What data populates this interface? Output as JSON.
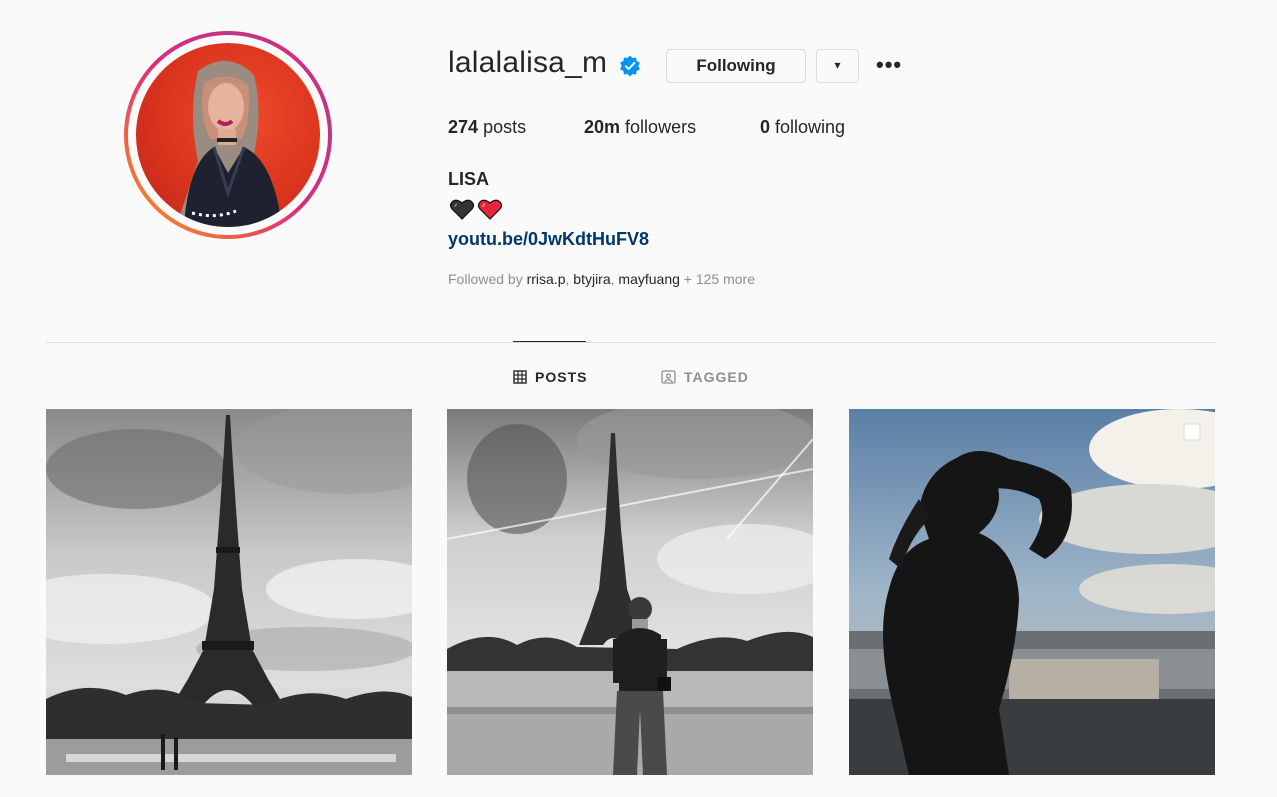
{
  "profile": {
    "username": "lalalalisa_m",
    "verified": true,
    "following_label": "Following",
    "dropdown_glyph": "▾",
    "more_glyph": "•••",
    "posts_count": "274",
    "posts_label": "posts",
    "followers_count": "20m",
    "followers_label": "followers",
    "following_count": "0",
    "following_stat_label": "following",
    "full_name": "LISA",
    "bio_emoji": "🖤❤️",
    "bio_link": "youtu.be/0JwKdtHuFV8",
    "followed_by_prefix": "Followed by",
    "followed_by_names": [
      "rrisa.p",
      "btyjira",
      "mayfuang"
    ],
    "followed_by_more": "+ 125 more",
    "accent_color": "#0095f6",
    "link_color": "#00376b"
  },
  "tabs": [
    {
      "label": "POSTS",
      "icon": "grid-icon",
      "active": true
    },
    {
      "label": "TAGGED",
      "icon": "tagged-icon",
      "active": false
    }
  ],
  "posts": [
    {
      "icon": "eiffel-tower-photo"
    },
    {
      "icon": "eiffel-tower-portrait-photo"
    },
    {
      "icon": "paris-rooftop-photo",
      "multi": true
    }
  ]
}
